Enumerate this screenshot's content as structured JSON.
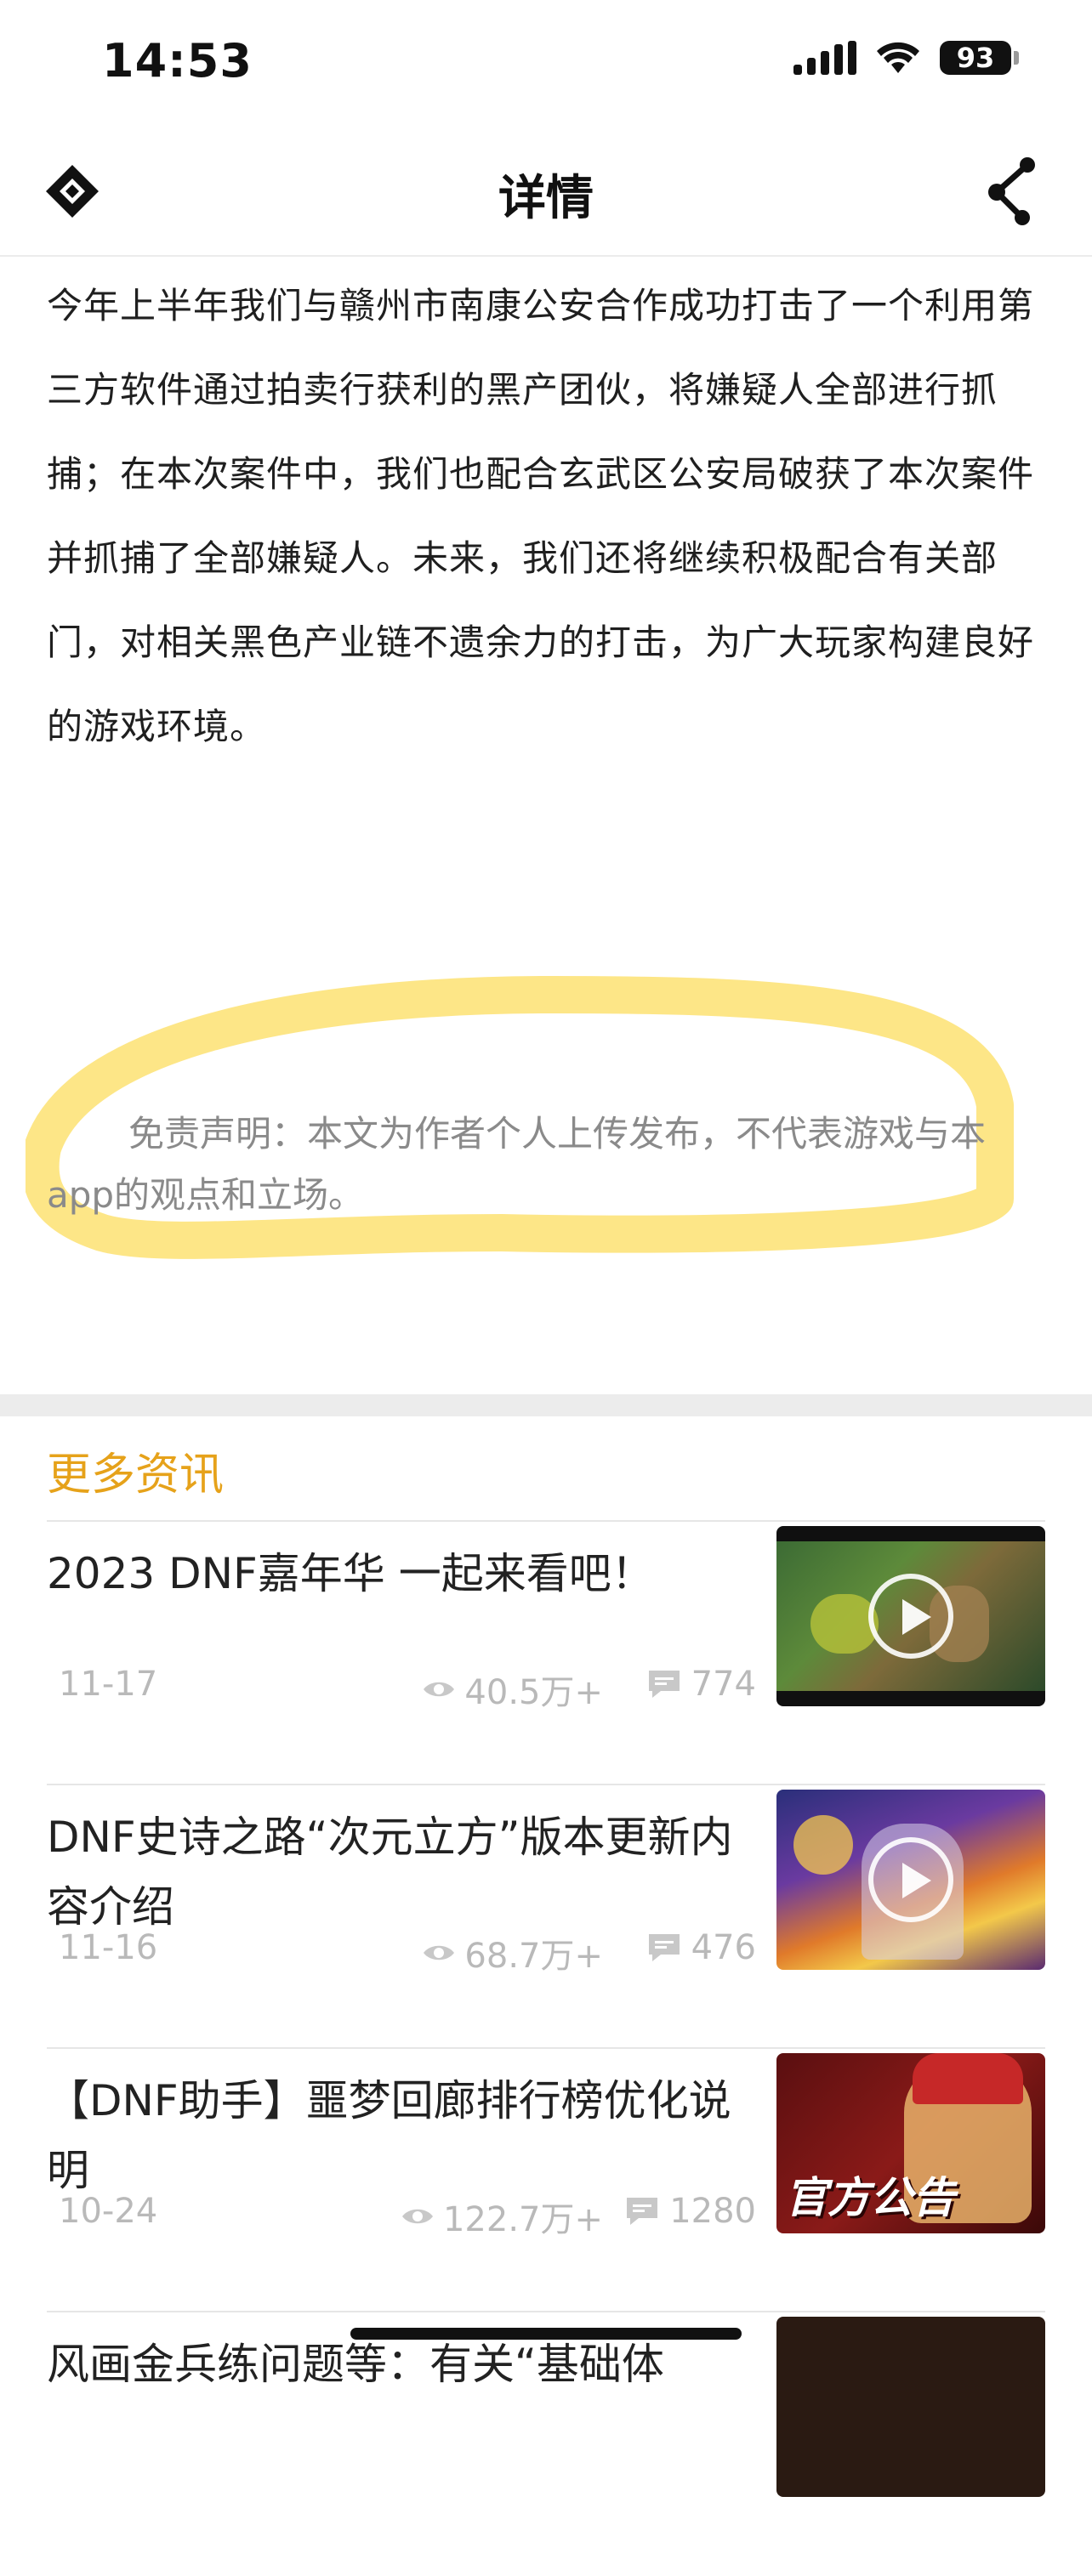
{
  "status_bar": {
    "time": "14:53",
    "battery": "93"
  },
  "nav": {
    "title": "详情"
  },
  "article": {
    "body": "今年上半年我们与赣州市南康公安合作成功打击了一个利用第三方软件通过拍卖行获利的黑产团伙，将嫌疑人全部进行抓捕；在本次案件中，我们也配合玄武区公安局破获了本次案件并抓捕了全部嫌疑人。未来，我们还将继续积极配合有关部门，对相关黑色产业链不遗余力的打击，为广大玩家构建良好的游戏环境。"
  },
  "disclaimer": {
    "text": "免责声明：本文为作者个人上传发布，不代表游戏与本app的观点和立场。"
  },
  "more_news": {
    "title": "更多资讯",
    "items": [
      {
        "title": "2023 DNF嘉年华 一起来看吧！",
        "date": "11-17",
        "views": "40.5万+",
        "comments": "774",
        "thumb": "video-green"
      },
      {
        "title": "DNF史诗之路“次元立方”版本更新内容介绍",
        "date": "11-16",
        "views": "68.7万+",
        "comments": "476",
        "thumb": "video-fantasy"
      },
      {
        "title": "【DNF助手】噩梦回廊排行榜优化说明",
        "date": "10-24",
        "views": "122.7万+",
        "comments": "1280",
        "thumb_text": "官方公告"
      },
      {
        "title": "风画金兵练问题等：有关“基础体",
        "date": "",
        "views": "",
        "comments": ""
      }
    ]
  },
  "colors": {
    "accent": "#e6a21a",
    "highlight": "#fde37a",
    "text": "#1f1f1f",
    "meta": "#b9b9b9"
  },
  "icons": {
    "logo": "diamond-logo-icon",
    "share": "share-icon",
    "views": "eye-icon",
    "comments": "comment-bubble-icon",
    "play": "play-icon"
  }
}
